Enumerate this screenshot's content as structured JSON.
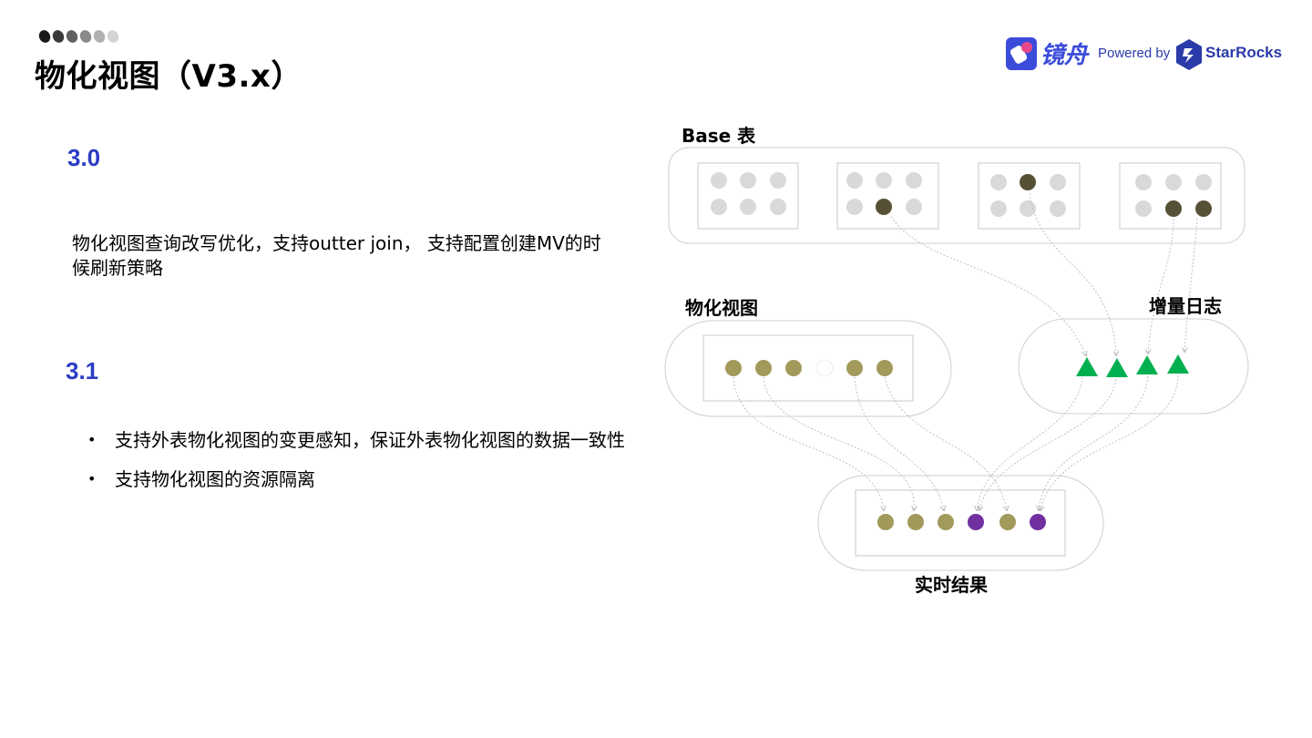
{
  "header": {
    "title": "物化视图（V3.x）"
  },
  "logo": {
    "product_name": "镜舟",
    "powered_by": "Powered by",
    "brand_name": "StarRocks",
    "brand_color": "#2a3aa8"
  },
  "section_30": {
    "version": "3.0",
    "text": "物化视图查询改写优化，支持outter join， 支持配置创建MV的时候刷新策略"
  },
  "section_31": {
    "version": "3.1",
    "bullets": [
      "支持外表物化视图的变更感知，保证外表物化视图的数据一致性",
      "支持物化视图的资源隔离"
    ]
  },
  "diagram": {
    "base_label": "Base 表",
    "mv_label": "物化视图",
    "log_label": "增量日志",
    "result_label": "实时结果",
    "colors": {
      "empty": "#d9d9d9",
      "changed": "#565136",
      "mv": "#a19a5a",
      "log": "#00b050",
      "new": "#7030a0"
    }
  }
}
